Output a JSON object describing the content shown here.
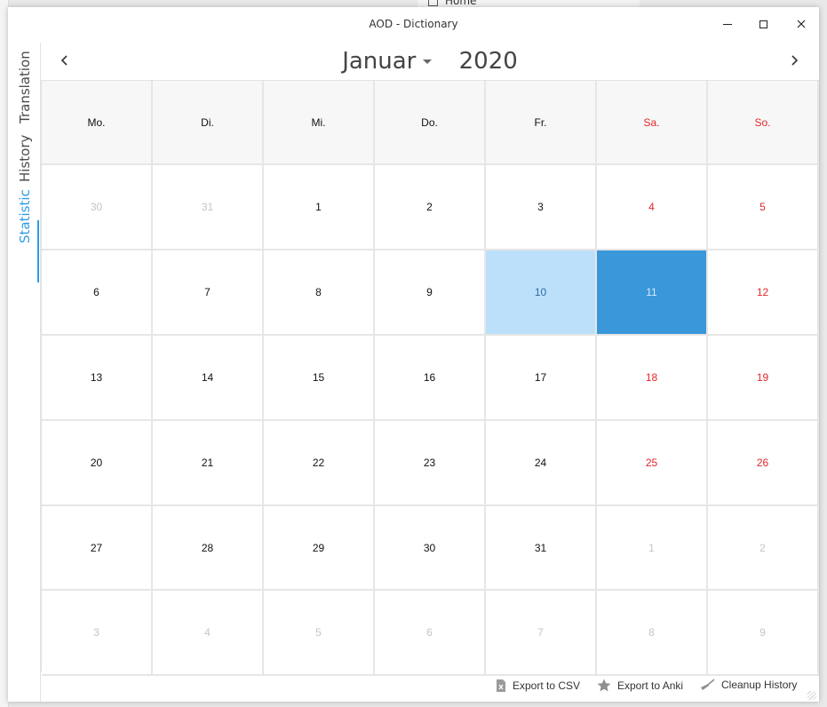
{
  "background": {
    "home_label": "Home"
  },
  "window": {
    "title": "AOD - Dictionary"
  },
  "tabs": [
    {
      "label": "Translation",
      "active": false
    },
    {
      "label": "History",
      "active": false
    },
    {
      "label": "Statistic",
      "active": true
    }
  ],
  "calendar": {
    "month": "Januar",
    "year": "2020",
    "weekdays": [
      "Mo.",
      "Di.",
      "Mi.",
      "Do.",
      "Fr.",
      "Sa.",
      "So."
    ],
    "weeks": [
      [
        "30",
        "31",
        "1",
        "2",
        "3",
        "4",
        "5"
      ],
      [
        "6",
        "7",
        "8",
        "9",
        "10",
        "11",
        "12"
      ],
      [
        "13",
        "14",
        "15",
        "16",
        "17",
        "18",
        "19"
      ],
      [
        "20",
        "21",
        "22",
        "23",
        "24",
        "25",
        "26"
      ],
      [
        "27",
        "28",
        "29",
        "30",
        "31",
        "1",
        "2"
      ],
      [
        "3",
        "4",
        "5",
        "6",
        "7",
        "8",
        "9"
      ]
    ],
    "today": "10",
    "selected": "11",
    "colors": {
      "weekend": "#e3262a",
      "selected": "#3a97d9",
      "today": "#bde0fa",
      "accent": "#2f9be3"
    }
  },
  "footer": {
    "export_csv": "Export to CSV",
    "export_anki": "Export to Anki",
    "cleanup": "Cleanup History"
  }
}
